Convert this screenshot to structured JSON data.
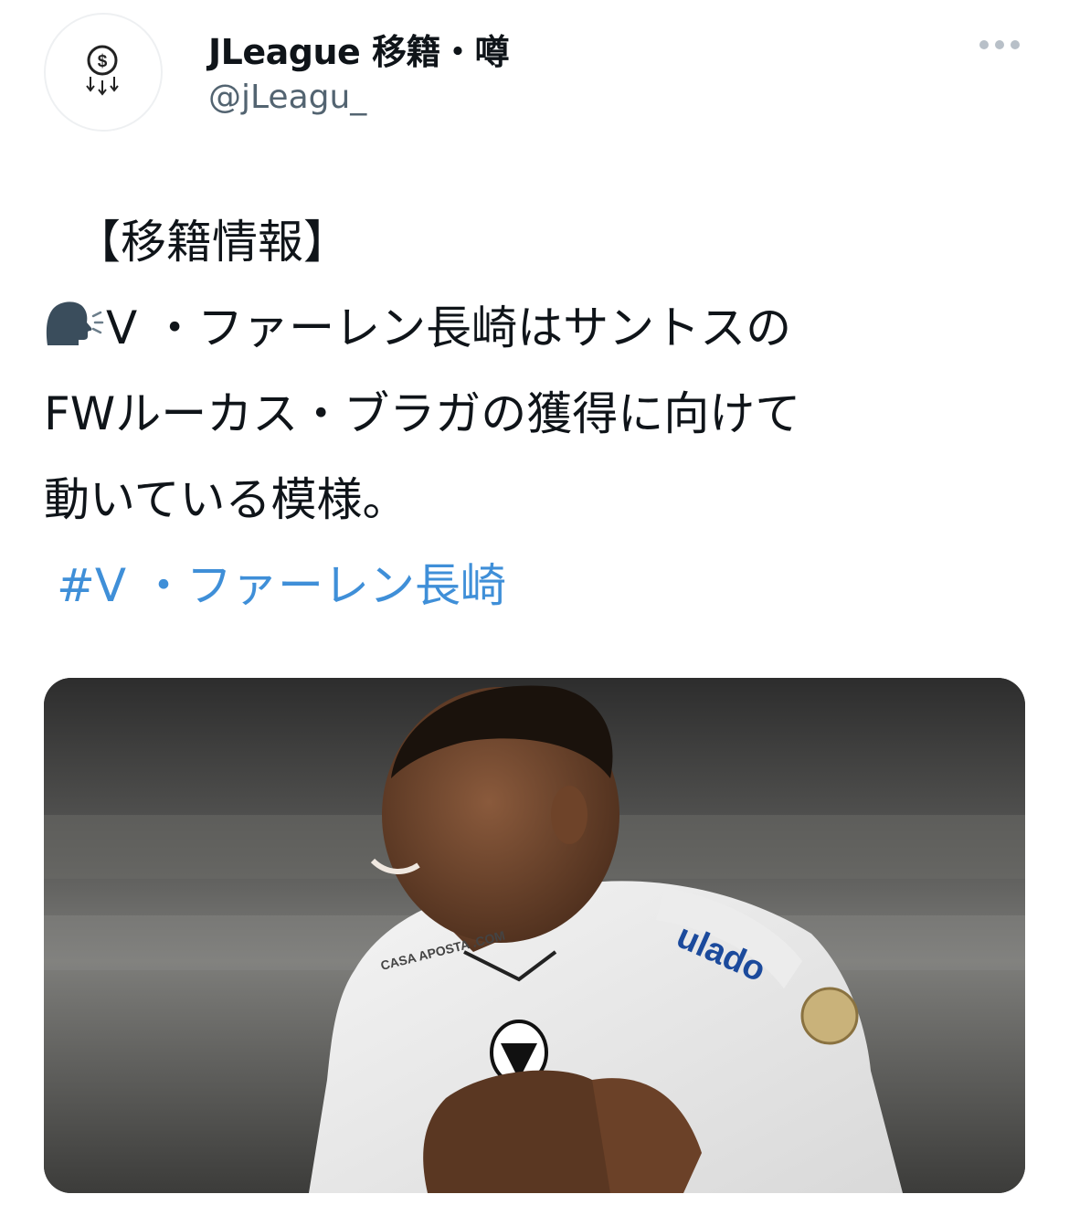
{
  "tweet": {
    "author": {
      "display_name": "JLeague 移籍・噂",
      "handle": "@jLeagu_",
      "avatar_icon": "dollar-coin-down-arrows-icon"
    },
    "more_icon": "more-options-icon",
    "text_lines": [
      "【移籍情報】",
      "V ・ファーレン長崎はサントスの",
      "FWルーカス・ブラガの獲得に向けて",
      "動いている模様。"
    ],
    "speaking_icon": "speaking-head-icon",
    "hashtag": "#V ・ファーレン長崎",
    "media": {
      "kind": "photo",
      "shirt_sponsor": "CASA APOSTA .COM",
      "sleeve_text": "ulado"
    },
    "colors": {
      "text": "#0f1419",
      "secondary": "#536471",
      "link": "#3f8fd8"
    }
  }
}
